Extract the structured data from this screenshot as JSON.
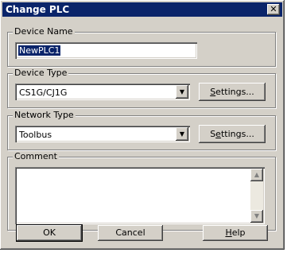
{
  "window": {
    "title": "Change PLC",
    "close_glyph": "✕"
  },
  "device_name": {
    "group_label": "Device Name",
    "value": "NewPLC1"
  },
  "device_type": {
    "group_label": "Device Type",
    "selected": "CS1G/CJ1G",
    "settings_prefix": "",
    "settings_mnemonic": "S",
    "settings_rest": "ettings..."
  },
  "network_type": {
    "group_label": "Network Type",
    "selected": "Toolbus",
    "settings_prefix": "S",
    "settings_mnemonic": "e",
    "settings_rest": "ttings..."
  },
  "comment": {
    "group_label": "Comment",
    "value": ""
  },
  "buttons": {
    "ok": "OK",
    "cancel": "Cancel",
    "help_mnemonic": "H",
    "help_rest": "elp"
  },
  "icons": {
    "dropdown": "▼",
    "scroll_up": "▲",
    "scroll_down": "▼"
  }
}
